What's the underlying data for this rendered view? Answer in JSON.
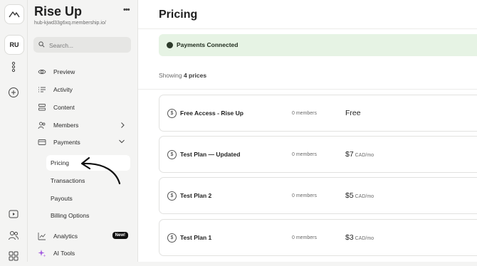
{
  "app": {
    "title": "Rise Up",
    "url": "hub-kjwd33g6xq.membership.io/",
    "more": "•••",
    "rail_workspace": "RU"
  },
  "search": {
    "placeholder": "Search..."
  },
  "nav": {
    "preview": "Preview",
    "activity": "Activity",
    "content": "Content",
    "members": "Members",
    "payments": "Payments",
    "pricing": "Pricing",
    "transactions": "Transactions",
    "payouts": "Payouts",
    "billing_options": "Billing Options",
    "analytics": "Analytics",
    "analytics_badge": "New!",
    "ai_tools": "AI Tools"
  },
  "main": {
    "title": "Pricing",
    "banner": "Payments Connected",
    "showing_prefix": "Showing ",
    "showing_count": "4 prices",
    "prices": [
      {
        "name": "Free Access - Rise Up",
        "members": "0 members",
        "amount": "Free",
        "unit": ""
      },
      {
        "name": "Test Plan — Updated",
        "members": "0 members",
        "amount": "$7",
        "unit": " CAD/mo"
      },
      {
        "name": "Test Plan 2",
        "members": "0 members",
        "amount": "$5",
        "unit": " CAD/mo"
      },
      {
        "name": "Test Plan 1",
        "members": "0 members",
        "amount": "$3",
        "unit": " CAD/mo"
      }
    ]
  },
  "colors": {
    "banner_bg": "#e6f3e4",
    "active_bg": "#ffffff",
    "badge_bg": "#111111"
  }
}
